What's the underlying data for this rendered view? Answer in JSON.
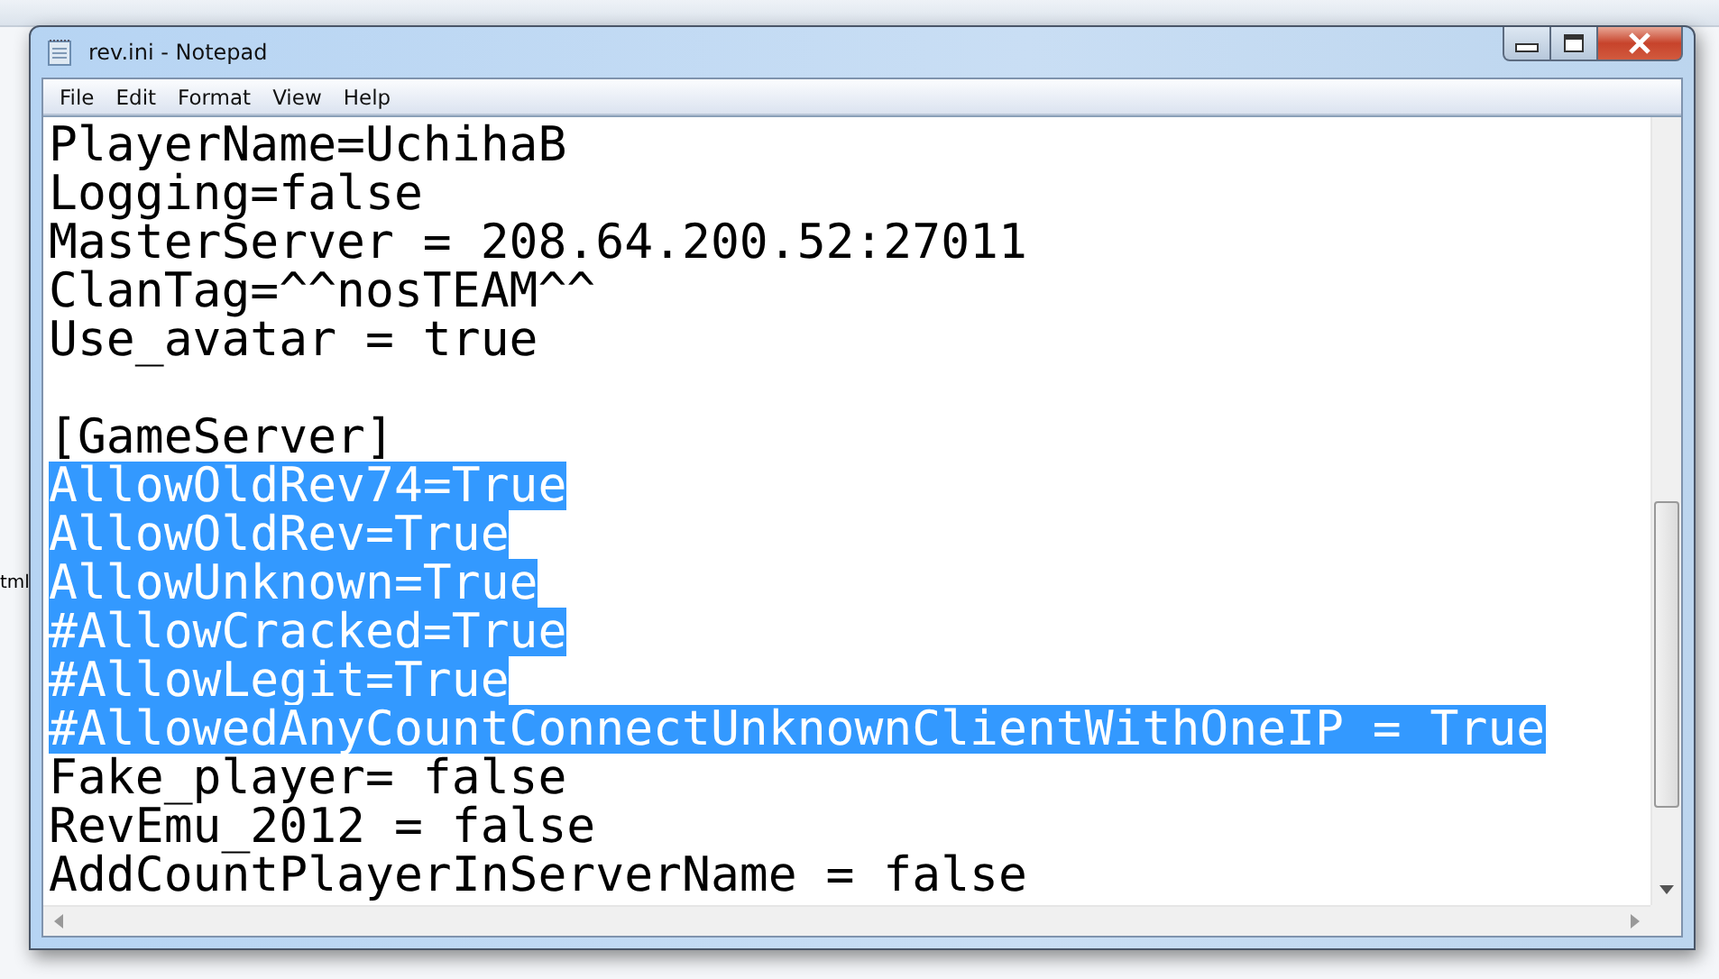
{
  "background": {
    "text": "tml"
  },
  "window": {
    "title": "rev.ini - Notepad"
  },
  "menu": [
    {
      "label": "File"
    },
    {
      "label": "Edit"
    },
    {
      "label": "Format"
    },
    {
      "label": "View"
    },
    {
      "label": "Help"
    }
  ],
  "lines": [
    {
      "kind": "text",
      "text": "PlayerName=UchihaB",
      "selected": false
    },
    {
      "kind": "text",
      "text": "Logging=false",
      "selected": false
    },
    {
      "kind": "text",
      "text": "MasterServer = 208.64.200.52:27011",
      "selected": false
    },
    {
      "kind": "text",
      "text": "ClanTag=^^nosTEAM^^",
      "selected": false
    },
    {
      "kind": "text",
      "text": "Use_avatar = true",
      "selected": false
    },
    {
      "kind": "blank"
    },
    {
      "kind": "text",
      "text": "[GameServer]",
      "selected": false
    },
    {
      "kind": "text",
      "text": "AllowOldRev74=True",
      "selected": true
    },
    {
      "kind": "text",
      "text": "AllowOldRev=True",
      "selected": true
    },
    {
      "kind": "text",
      "text": "AllowUnknown=True",
      "selected": true
    },
    {
      "kind": "text",
      "text": "#AllowCracked=True",
      "selected": true
    },
    {
      "kind": "text",
      "text": "#AllowLegit=True",
      "selected": true
    },
    {
      "kind": "text",
      "text": "#AllowedAnyCountConnectUnknownClientWithOneIP = True",
      "selected": true
    },
    {
      "kind": "text",
      "text": "Fake_player= false",
      "selected": false
    },
    {
      "kind": "text",
      "text": "RevEmu_2012 = false",
      "selected": false
    },
    {
      "kind": "text",
      "text": "AddCountPlayerInServerName = false",
      "selected": false
    }
  ]
}
